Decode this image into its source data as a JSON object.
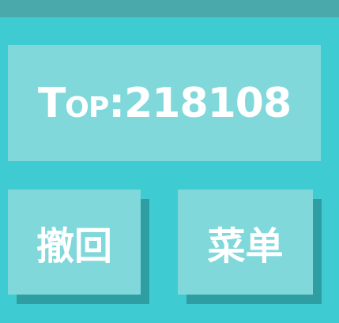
{
  "score": {
    "label": "Top:",
    "value": "218108"
  },
  "buttons": {
    "undo_label": "撤回",
    "menu_label": "菜单"
  },
  "colors": {
    "background": "#3fcbd2",
    "top_bar": "#4aaaab",
    "panel": "#80d8db",
    "button_shadow": "#2f9ea3",
    "text": "#ffffff"
  }
}
